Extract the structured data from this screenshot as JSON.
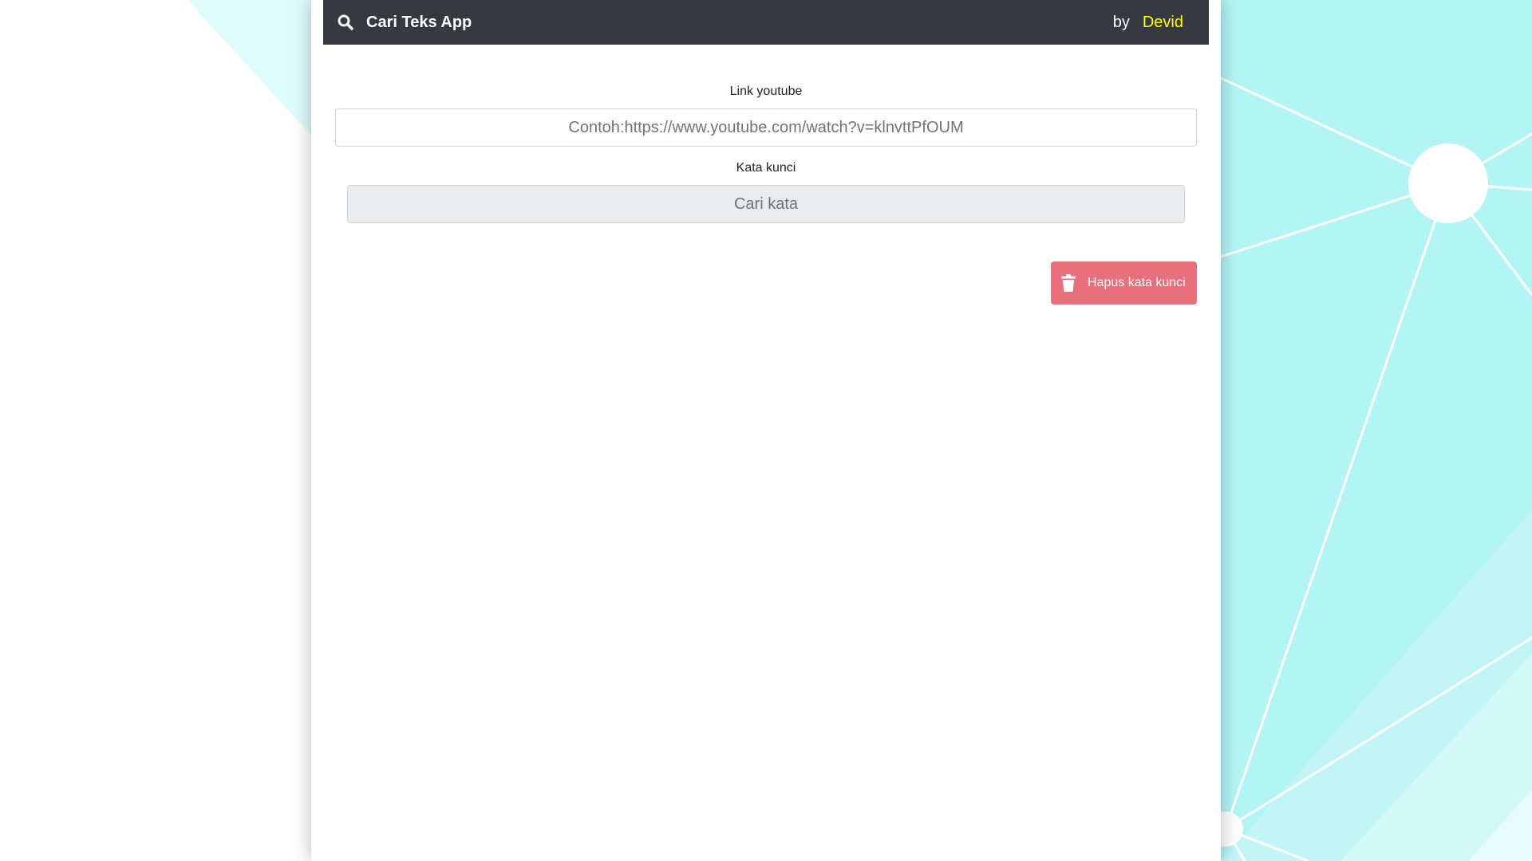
{
  "navbar": {
    "title": "Cari Teks App",
    "by_label": "by",
    "author": "Devid",
    "author_color": "#ffff00",
    "background": "#343a40"
  },
  "form": {
    "link_label": "Link youtube",
    "link_placeholder": "Contoh:https://www.youtube.com/watch?v=klnvttPfOUM",
    "link_value": "",
    "keyword_label": "Kata kunci",
    "keyword_placeholder": "Cari kata",
    "keyword_value": ""
  },
  "actions": {
    "delete_label": "Hapus kata kunci",
    "delete_color": "#e8707c",
    "delete_icon": "trash-icon"
  },
  "icons": {
    "brand": "search-icon"
  },
  "background": {
    "color": "#b3f5f5"
  }
}
